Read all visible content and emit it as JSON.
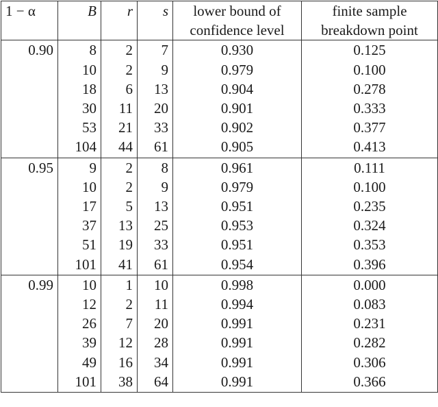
{
  "table": {
    "headers": {
      "alpha": "1 − α",
      "B": "B",
      "r": "r",
      "s": "s",
      "lower_bound": [
        "lower bound of",
        "confidence level"
      ],
      "breakdown": [
        "finite sample",
        "breakdown point"
      ]
    },
    "groups": [
      {
        "level": "0.90",
        "rows": [
          {
            "B": "8",
            "r": "2",
            "s": "7",
            "lb": "0.930",
            "bp": "0.125"
          },
          {
            "B": "10",
            "r": "2",
            "s": "9",
            "lb": "0.979",
            "bp": "0.100"
          },
          {
            "B": "18",
            "r": "6",
            "s": "13",
            "lb": "0.904",
            "bp": "0.278"
          },
          {
            "B": "30",
            "r": "11",
            "s": "20",
            "lb": "0.901",
            "bp": "0.333"
          },
          {
            "B": "53",
            "r": "21",
            "s": "33",
            "lb": "0.902",
            "bp": "0.377"
          },
          {
            "B": "104",
            "r": "44",
            "s": "61",
            "lb": "0.905",
            "bp": "0.413"
          }
        ]
      },
      {
        "level": "0.95",
        "rows": [
          {
            "B": "9",
            "r": "2",
            "s": "8",
            "lb": "0.961",
            "bp": "0.111"
          },
          {
            "B": "10",
            "r": "2",
            "s": "9",
            "lb": "0.979",
            "bp": "0.100"
          },
          {
            "B": "17",
            "r": "5",
            "s": "13",
            "lb": "0.951",
            "bp": "0.235"
          },
          {
            "B": "37",
            "r": "13",
            "s": "25",
            "lb": "0.953",
            "bp": "0.324"
          },
          {
            "B": "51",
            "r": "19",
            "s": "33",
            "lb": "0.951",
            "bp": "0.353"
          },
          {
            "B": "101",
            "r": "41",
            "s": "61",
            "lb": "0.954",
            "bp": "0.396"
          }
        ]
      },
      {
        "level": "0.99",
        "rows": [
          {
            "B": "10",
            "r": "1",
            "s": "10",
            "lb": "0.998",
            "bp": "0.000"
          },
          {
            "B": "12",
            "r": "2",
            "s": "11",
            "lb": "0.994",
            "bp": "0.083"
          },
          {
            "B": "26",
            "r": "7",
            "s": "20",
            "lb": "0.991",
            "bp": "0.231"
          },
          {
            "B": "39",
            "r": "12",
            "s": "28",
            "lb": "0.991",
            "bp": "0.282"
          },
          {
            "B": "49",
            "r": "16",
            "s": "34",
            "lb": "0.991",
            "bp": "0.306"
          },
          {
            "B": "101",
            "r": "38",
            "s": "64",
            "lb": "0.991",
            "bp": "0.366"
          }
        ]
      }
    ]
  }
}
